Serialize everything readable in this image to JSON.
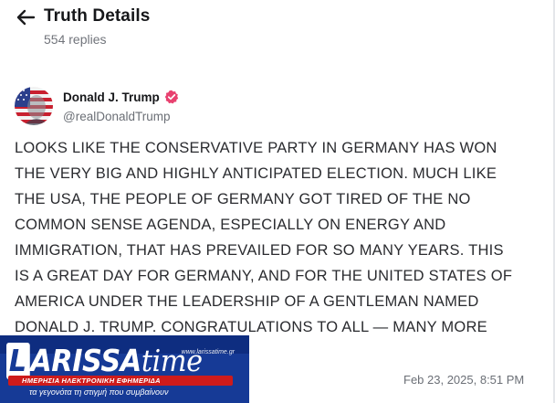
{
  "header": {
    "title": "Truth Details",
    "replies": "554 replies",
    "back_icon": "arrow-left-icon"
  },
  "author": {
    "name": "Donald J. Trump",
    "handle": "@realDonaldTrump",
    "verified_icon": "verified-badge-icon",
    "verified_color": "#e8416f"
  },
  "post": {
    "text": "LOOKS LIKE THE CONSERVATIVE PARTY  IN GERMANY HAS WON\nTHE VERY BIG AND HIGHLY ANTICIPATED ELECTION. MUCH LIKE\nTHE USA, THE PEOPLE OF GERMANY GOT TIRED OF THE NO\nCOMMON SENSE AGENDA, ESPECIALLY ON ENERGY AND\nIMMIGRATION, THAT HAS PREVAILED FOR SO MANY YEARS. THIS\nIS A GREAT DAY FOR GERMANY, AND FOR THE UNITED STATES OF\nAMERICA UNDER THE LEADERSHIP OF A GENTLEMAN NAMED\nDONALD J. TRUMP. CONGRATULATIONS TO ALL — MANY MORE",
    "timestamp": "Feb 23, 2025, 8:51 PM"
  },
  "watermark": {
    "logo_initial": "L",
    "logo_text": "ARISSA",
    "logo_time": "time",
    "url": "www.larissatime.gr",
    "subtitle": "ΗΜΕΡΗΣΙΑ ΗΛΕΚΤΡΟΝΙΚΗ ΕΦΗΜΕΡΙΔΑ",
    "tagline": "τα γεγονότα τη στιγμή που συμβαίνουν",
    "brand_color": "#163a96",
    "accent_color": "#ce1b1b"
  }
}
